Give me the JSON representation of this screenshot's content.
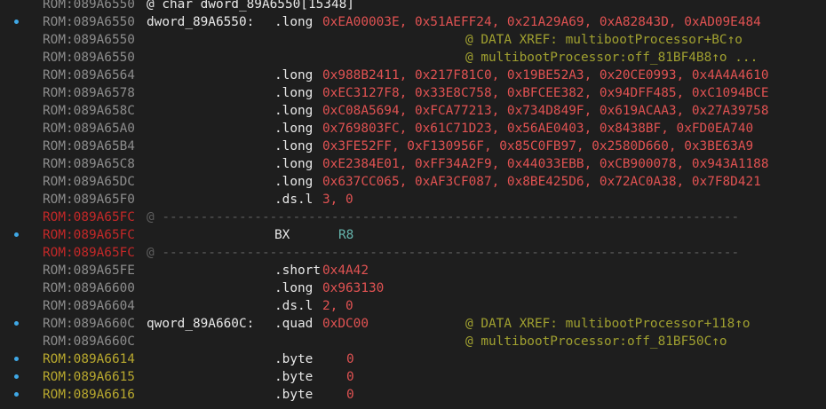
{
  "lines": [
    {
      "addr": "ROM:089A6550",
      "addr_color": "gray",
      "dot": false,
      "header": "@ char dword_89A6550[15348]"
    },
    {
      "addr": "ROM:089A6550",
      "addr_color": "gray",
      "dot": true,
      "label": "dword_89A6550:",
      "mnemonic": ".long",
      "operands": "0xEA00003E, 0x51AEFF24, 0x21A29A69, 0xA82843D, 0xAD09E484"
    },
    {
      "addr": "ROM:089A6550",
      "addr_color": "gray",
      "dot": false,
      "comment": "@ DATA XREF: multibootProcessor+BC↑o"
    },
    {
      "addr": "ROM:089A6550",
      "addr_color": "gray",
      "dot": false,
      "comment": "@ multibootProcessor:off_81BF4B8↑o ..."
    },
    {
      "addr": "ROM:089A6564",
      "addr_color": "gray",
      "dot": false,
      "mnemonic": ".long",
      "operands": "0x988B2411, 0x217F81C0, 0x19BE52A3, 0x20CE0993, 0x4A4A4610"
    },
    {
      "addr": "ROM:089A6578",
      "addr_color": "gray",
      "dot": false,
      "mnemonic": ".long",
      "operands": "0xEC3127F8, 0x33E8C758, 0xBFCEE382, 0x94DFF485, 0xC1094BCE"
    },
    {
      "addr": "ROM:089A658C",
      "addr_color": "gray",
      "dot": false,
      "mnemonic": ".long",
      "operands": "0xC08A5694, 0xFCA77213, 0x734D849F, 0x619ACAA3, 0x27A39758"
    },
    {
      "addr": "ROM:089A65A0",
      "addr_color": "gray",
      "dot": false,
      "mnemonic": ".long",
      "operands": "0x769803FC, 0x61C71D23, 0x56AE0403, 0x8438BF, 0xFD0EA740"
    },
    {
      "addr": "ROM:089A65B4",
      "addr_color": "gray",
      "dot": false,
      "mnemonic": ".long",
      "operands": "0x3FE52FF, 0xF130956F, 0x85C0FB97, 0x2580D660, 0x3BE63A9"
    },
    {
      "addr": "ROM:089A65C8",
      "addr_color": "gray",
      "dot": false,
      "mnemonic": ".long",
      "operands": "0xE2384E01, 0xFF34A2F9, 0x44033EBB, 0xCB900078, 0x943A1188"
    },
    {
      "addr": "ROM:089A65DC",
      "addr_color": "gray",
      "dot": false,
      "mnemonic": ".long",
      "operands": "0x637CC065, 0xAF3CF087, 0x8BE425D6, 0x72AC0A38, 0x7F8D421"
    },
    {
      "addr": "ROM:089A65F0",
      "addr_color": "gray",
      "dot": false,
      "mnemonic": ".ds.l",
      "operands": "3, 0"
    },
    {
      "addr": "ROM:089A65FC",
      "addr_color": "red",
      "dot": false,
      "separator": "@ ---------------------------------------------------------------------------"
    },
    {
      "addr": "ROM:089A65FC",
      "addr_color": "red",
      "dot": true,
      "mnemonic": "BX",
      "register": "R8"
    },
    {
      "addr": "ROM:089A65FC",
      "addr_color": "red",
      "dot": false,
      "separator": "@ ---------------------------------------------------------------------------"
    },
    {
      "addr": "ROM:089A65FE",
      "addr_color": "gray",
      "dot": false,
      "mnemonic": ".short",
      "operands": "0x4A42"
    },
    {
      "addr": "ROM:089A6600",
      "addr_color": "gray",
      "dot": false,
      "mnemonic": ".long",
      "operands": "0x963130"
    },
    {
      "addr": "ROM:089A6604",
      "addr_color": "gray",
      "dot": false,
      "mnemonic": ".ds.l",
      "operands": "2, 0"
    },
    {
      "addr": "ROM:089A660C",
      "addr_color": "gray",
      "dot": true,
      "label": "qword_89A660C:",
      "mnemonic": ".quad",
      "operands": "0xDC00",
      "comment": "@ DATA XREF: multibootProcessor+118↑o"
    },
    {
      "addr": "ROM:089A660C",
      "addr_color": "gray",
      "dot": false,
      "comment": "@ multibootProcessor:off_81BF50C↑o"
    },
    {
      "addr": "ROM:089A6614",
      "addr_color": "yellow",
      "dot": true,
      "mnemonic": ".byte",
      "operands": "0",
      "operands_far": true
    },
    {
      "addr": "ROM:089A6615",
      "addr_color": "yellow",
      "dot": true,
      "mnemonic": ".byte",
      "operands": "0",
      "operands_far": true
    },
    {
      "addr": "ROM:089A6616",
      "addr_color": "yellow",
      "dot": true,
      "mnemonic": ".byte",
      "operands": "0",
      "operands_far": true
    }
  ]
}
